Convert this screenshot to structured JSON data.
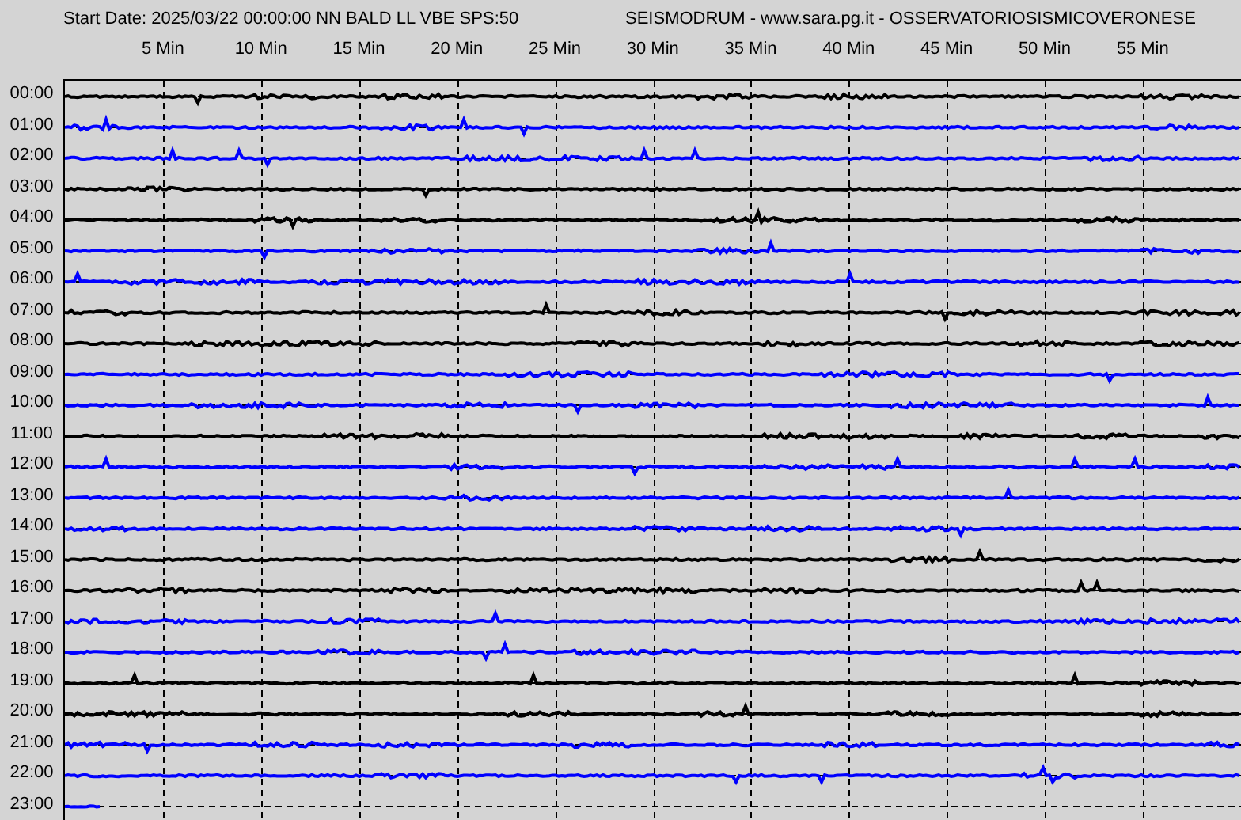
{
  "header": {
    "title": "Start Date: 2025/03/22 00:00:00 NN BALD LL VBE SPS:50",
    "source": "SEISMODRUM - www.sara.pg.it - OSSERVATORIOSISMICOVERONESE"
  },
  "minute_labels": [
    "5 Min",
    "10 Min",
    "15 Min",
    "20 Min",
    "25 Min",
    "30 Min",
    "35 Min",
    "40 Min",
    "45 Min",
    "50 Min",
    "55 Min"
  ],
  "rows": [
    {
      "time": "00:00",
      "color": "#000000",
      "level": 1
    },
    {
      "time": "01:00",
      "color": "#0000ff",
      "level": 1
    },
    {
      "time": "02:00",
      "color": "#0000ff",
      "level": 1
    },
    {
      "time": "03:00",
      "color": "#000000",
      "level": 1
    },
    {
      "time": "04:00",
      "color": "#000000",
      "level": 1
    },
    {
      "time": "05:00",
      "color": "#0000ff",
      "level": 1
    },
    {
      "time": "06:00",
      "color": "#0000ff",
      "level": 1
    },
    {
      "time": "07:00",
      "color": "#000000",
      "level": 1
    },
    {
      "time": "08:00",
      "color": "#000000",
      "level": 1
    },
    {
      "time": "09:00",
      "color": "#0000ff",
      "level": 1
    },
    {
      "time": "10:00",
      "color": "#0000ff",
      "level": 1
    },
    {
      "time": "11:00",
      "color": "#000000",
      "level": 1
    },
    {
      "time": "12:00",
      "color": "#0000ff",
      "level": 1
    },
    {
      "time": "13:00",
      "color": "#0000ff",
      "level": 1
    },
    {
      "time": "14:00",
      "color": "#0000ff",
      "level": 1
    },
    {
      "time": "15:00",
      "color": "#000000",
      "level": 1
    },
    {
      "time": "16:00",
      "color": "#000000",
      "level": 1
    },
    {
      "time": "17:00",
      "color": "#0000ff",
      "level": 1
    },
    {
      "time": "18:00",
      "color": "#0000ff",
      "level": 1
    },
    {
      "time": "19:00",
      "color": "#000000",
      "level": 1
    },
    {
      "time": "20:00",
      "color": "#000000",
      "level": 1
    },
    {
      "time": "21:00",
      "color": "#0000ff",
      "level": 1
    },
    {
      "time": "22:00",
      "color": "#0000ff",
      "level": 1
    },
    {
      "time": "23:00",
      "color": "#0000ff",
      "level": 0.03
    }
  ]
}
